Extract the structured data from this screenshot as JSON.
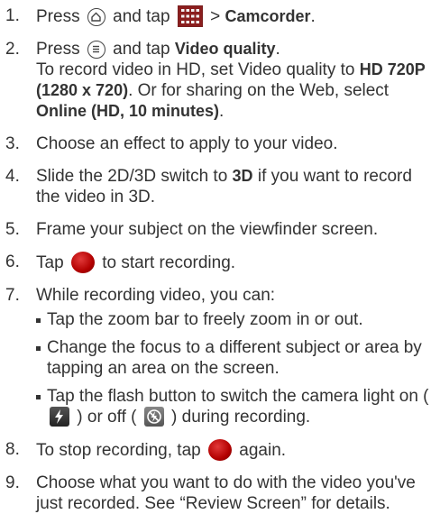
{
  "steps": [
    {
      "number": "1.",
      "parts": {
        "press": "Press",
        "and_tap": "and tap",
        "gt": ">",
        "target": "Camcorder",
        "end": "."
      }
    },
    {
      "number": "2.",
      "parts": {
        "press": "Press",
        "and_tap": "and tap",
        "target": "Video quality",
        "end": "."
      },
      "detail": {
        "t1": "To record video in HD, set Video quality to",
        "b1": "HD 720P (1280 x 720)",
        "t2": ". Or for sharing on the Web, select",
        "b2": "Online (HD, 10 minutes)",
        "t3": "."
      }
    },
    {
      "number": "3.",
      "text": "Choose an effect to apply to your video."
    },
    {
      "number": "4.",
      "text_before": "Slide the 2D/3D switch to",
      "bold": "3D",
      "text_after": "if you want to record the video in 3D."
    },
    {
      "number": "5.",
      "text": "Frame your subject on the viewfinder screen."
    },
    {
      "number": "6.",
      "tap": "Tap",
      "text_after": "to start recording."
    },
    {
      "number": "7.",
      "text": "While recording video, you can:",
      "bullets": [
        "Tap the zoom bar to freely zoom in or out.",
        "Change the focus to a different subject or area by tapping an area on the screen."
      ],
      "flash_bullet": {
        "before": "Tap the flash button to switch the camera light on (",
        "middle": ") or off (",
        "after": ") during recording."
      }
    },
    {
      "number": "8.",
      "text_before": "To stop recording, tap",
      "text_after": "again."
    },
    {
      "number": "9.",
      "text": "Choose what you want to do with the video you've just recorded. See “Review Screen” for details."
    }
  ]
}
